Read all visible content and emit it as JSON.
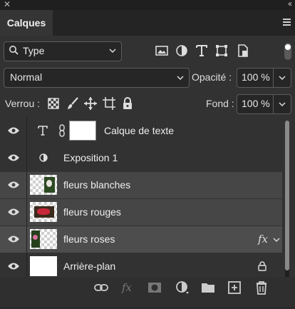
{
  "panel": {
    "tab_label": "Calques",
    "filter_label": "Type",
    "blend_mode": "Normal",
    "opacity_label": "Opacité :",
    "opacity_value": "100 %",
    "lock_label": "Verrou :",
    "fill_label": "Fond :",
    "fill_value": "100 %"
  },
  "filter_icons": [
    "image-filter-icon",
    "adjustment-filter-icon",
    "type-filter-icon",
    "shape-filter-icon",
    "smart-object-filter-icon"
  ],
  "lock_icons": [
    "lock-transparency-icon",
    "lock-image-pixels-icon",
    "lock-position-icon",
    "lock-artboard-icon",
    "lock-all-icon"
  ],
  "layers": [
    {
      "name": "Calque de texte",
      "kind": "text",
      "selected": false
    },
    {
      "name": "Exposition 1",
      "kind": "adjustment",
      "selected": false
    },
    {
      "name": "fleurs blanches",
      "kind": "image",
      "selected": true
    },
    {
      "name": "fleurs rouges",
      "kind": "image",
      "selected": true
    },
    {
      "name": "fleurs roses",
      "kind": "image",
      "selected": true,
      "fx": "fx"
    },
    {
      "name": "Arrière-plan",
      "kind": "background",
      "selected": false,
      "locked": true
    }
  ],
  "bottom_icons": [
    "link-layers-icon",
    "fx-icon",
    "mask-icon",
    "adjustment-layer-icon",
    "group-folder-icon",
    "new-layer-icon",
    "trash-icon"
  ],
  "colors": {
    "panel_bg": "#323232",
    "selected_row": "#464646",
    "text": "#e6e6e6"
  }
}
